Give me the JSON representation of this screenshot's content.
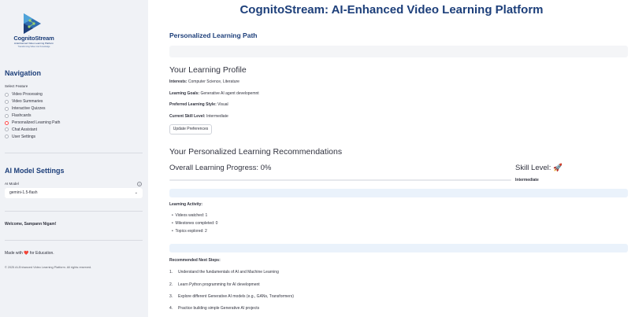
{
  "app_title": "CognitoStream: AI-Enhanced Video Learning Platform",
  "logo": {
    "title": "CognitoStream",
    "subtitle": "AI-Enhanced Video Learning Platform",
    "tagline": "Transforming Video into Knowledge"
  },
  "sidebar": {
    "nav_heading": "Navigation",
    "select_feature_label": "Select Feature",
    "features": [
      {
        "label": "Video Processing",
        "selected": false
      },
      {
        "label": "Video Summaries",
        "selected": false
      },
      {
        "label": "Interactive Quizzes",
        "selected": false
      },
      {
        "label": "Flashcards",
        "selected": false
      },
      {
        "label": "Personalized Learning Path",
        "selected": true
      },
      {
        "label": "Chat Assistant",
        "selected": false
      },
      {
        "label": "User Settings",
        "selected": false
      }
    ],
    "ai_settings_heading": "AI Model Settings",
    "ai_model_label": "AI Model",
    "ai_model_value": "gemini-1.5-flash",
    "welcome": "Welcome, Sampann Nigam!",
    "made_with_prefix": "Made with",
    "made_with_heart": "❤️",
    "made_with_suffix": "for Education.",
    "copyright": "© 2025 AI-Enhanced Video Learning Platform. All rights reserved."
  },
  "main": {
    "section_title": "Personalized Learning Path",
    "profile_heading": "Your Learning Profile",
    "profile": {
      "interests_label": "Interests:",
      "interests_value": "Computer Science, Literature",
      "goals_label": "Learning Goals:",
      "goals_value": "Generative AI agent developemnt",
      "style_label": "Preferred Learning Style:",
      "style_value": "Visual",
      "level_label": "Current Skill Level:",
      "level_value": "Intermediate"
    },
    "update_button": "Update Preferences",
    "recommendations_heading": "Your Personalized Learning Recommendations",
    "progress_label": "Overall Learning Progress: 0%",
    "progress_value": 0,
    "skill_label": "Skill Level: 🚀",
    "skill_value": "Intermediate",
    "activity_heading": "Learning Activity:",
    "activity": [
      "Videos watched: 1",
      "Milestones completed: 0",
      "Topics explored: 2"
    ],
    "next_steps_heading": "Recommended Next Steps:",
    "next_steps": [
      {
        "num": "1.",
        "text": "Understand the fundamentals of AI and Machine Learning"
      },
      {
        "num": "2.",
        "text": "Learn Python programming for AI development"
      },
      {
        "num": "3.",
        "text": "Explore different Generative AI models (e.g., GANs, Transformers)"
      },
      {
        "num": "4.",
        "text": "Practice building simple Generative AI projects"
      }
    ]
  },
  "colors": {
    "accent": "#ff4b4b",
    "brand": "#1d3f7a",
    "sidebar_bg": "#f0f2f6"
  }
}
